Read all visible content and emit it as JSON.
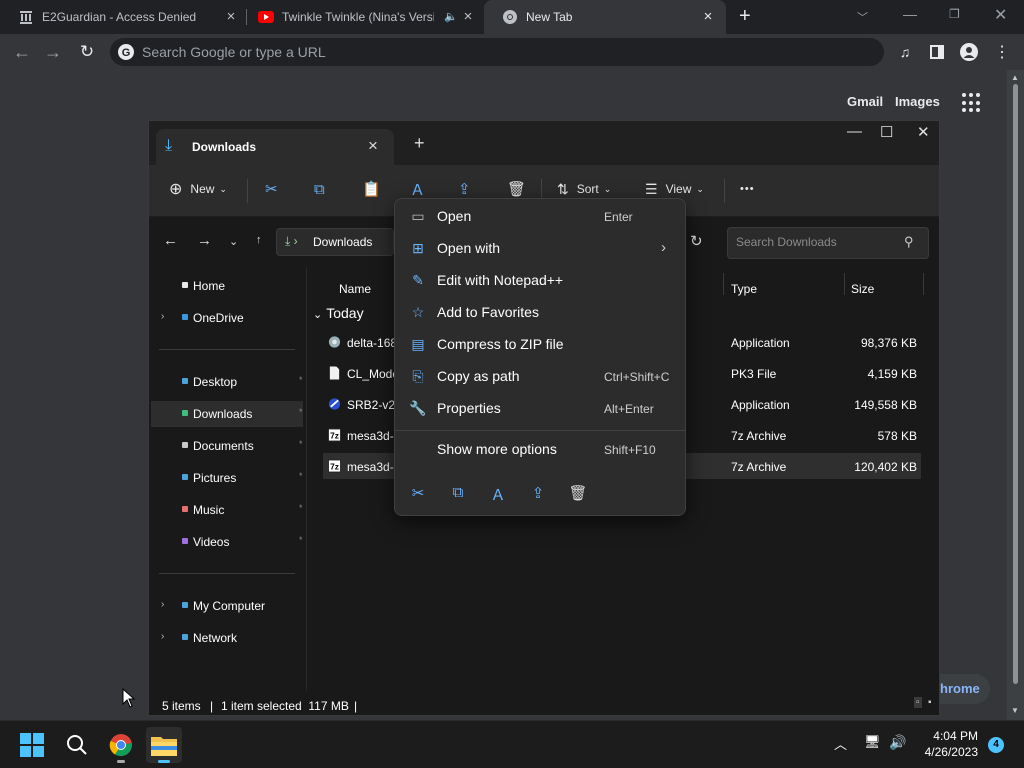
{
  "chrome": {
    "tabs": [
      {
        "title": "E2Guardian - Access Denied",
        "close": "×"
      },
      {
        "title": "Twinkle Twinkle (Nina's Versi",
        "close": "×"
      },
      {
        "title": "New Tab",
        "close": "×"
      }
    ],
    "new_tab": "+",
    "omnibox_placeholder": "Search Google or type a URL",
    "gmail": "Gmail",
    "images": "Images",
    "customize_label": "hrome"
  },
  "explorer": {
    "tab_title": "Downloads",
    "tab_close": "×",
    "newtab": "+",
    "commands": {
      "new_label": "New",
      "sort_label": "Sort",
      "view_label": "View",
      "more": "•••"
    },
    "address": {
      "current": "Downloads"
    },
    "search_placeholder": "Search Downloads",
    "nav": [
      {
        "label": "Home",
        "color": "#e8e8e8"
      },
      {
        "label": "OneDrive",
        "color": "#3a96dd"
      },
      {
        "label": "Desktop",
        "color": "#4aa3df"
      },
      {
        "label": "Downloads",
        "color": "#3fbf7f"
      },
      {
        "label": "Documents",
        "color": "#c8c8c8"
      },
      {
        "label": "Pictures",
        "color": "#4aa3df"
      },
      {
        "label": "Music",
        "color": "#e87070"
      },
      {
        "label": "Videos",
        "color": "#a070e0"
      },
      {
        "label": "My Computer",
        "color": "#4aa3df"
      },
      {
        "label": "Network",
        "color": "#4aa3df"
      }
    ],
    "columns": {
      "name": "Name",
      "type": "Type",
      "size": "Size"
    },
    "group": "Today",
    "files": [
      {
        "name": "delta-168",
        "type": "Application",
        "size": "98,376 KB"
      },
      {
        "name": "CL_Mode",
        "type": "PK3 File",
        "size": "4,159 KB"
      },
      {
        "name": "SRB2-v22",
        "type": "Application",
        "size": "149,558 KB"
      },
      {
        "name": "mesa3d-",
        "type": "7z Archive",
        "size": "578 KB"
      },
      {
        "name": "mesa3d-",
        "type": "7z Archive",
        "size": "120,402 KB"
      }
    ],
    "status": {
      "count": "5 items",
      "sep": "|",
      "selected": "1 item selected  117 MB",
      "end": "|"
    }
  },
  "context_menu": {
    "items": [
      {
        "label": "Open",
        "shortcut": "Enter"
      },
      {
        "label": "Open with",
        "shortcut": ""
      },
      {
        "label": "Edit with Notepad++",
        "shortcut": ""
      },
      {
        "label": "Add to Favorites",
        "shortcut": ""
      },
      {
        "label": "Compress to ZIP file",
        "shortcut": ""
      },
      {
        "label": "Copy as path",
        "shortcut": "Ctrl+Shift+C"
      },
      {
        "label": "Properties",
        "shortcut": "Alt+Enter"
      },
      {
        "label": "Show more options",
        "shortcut": "Shift+F10"
      }
    ]
  },
  "taskbar": {
    "time": "4:04 PM",
    "date": "4/26/2023",
    "notifications": "4"
  }
}
